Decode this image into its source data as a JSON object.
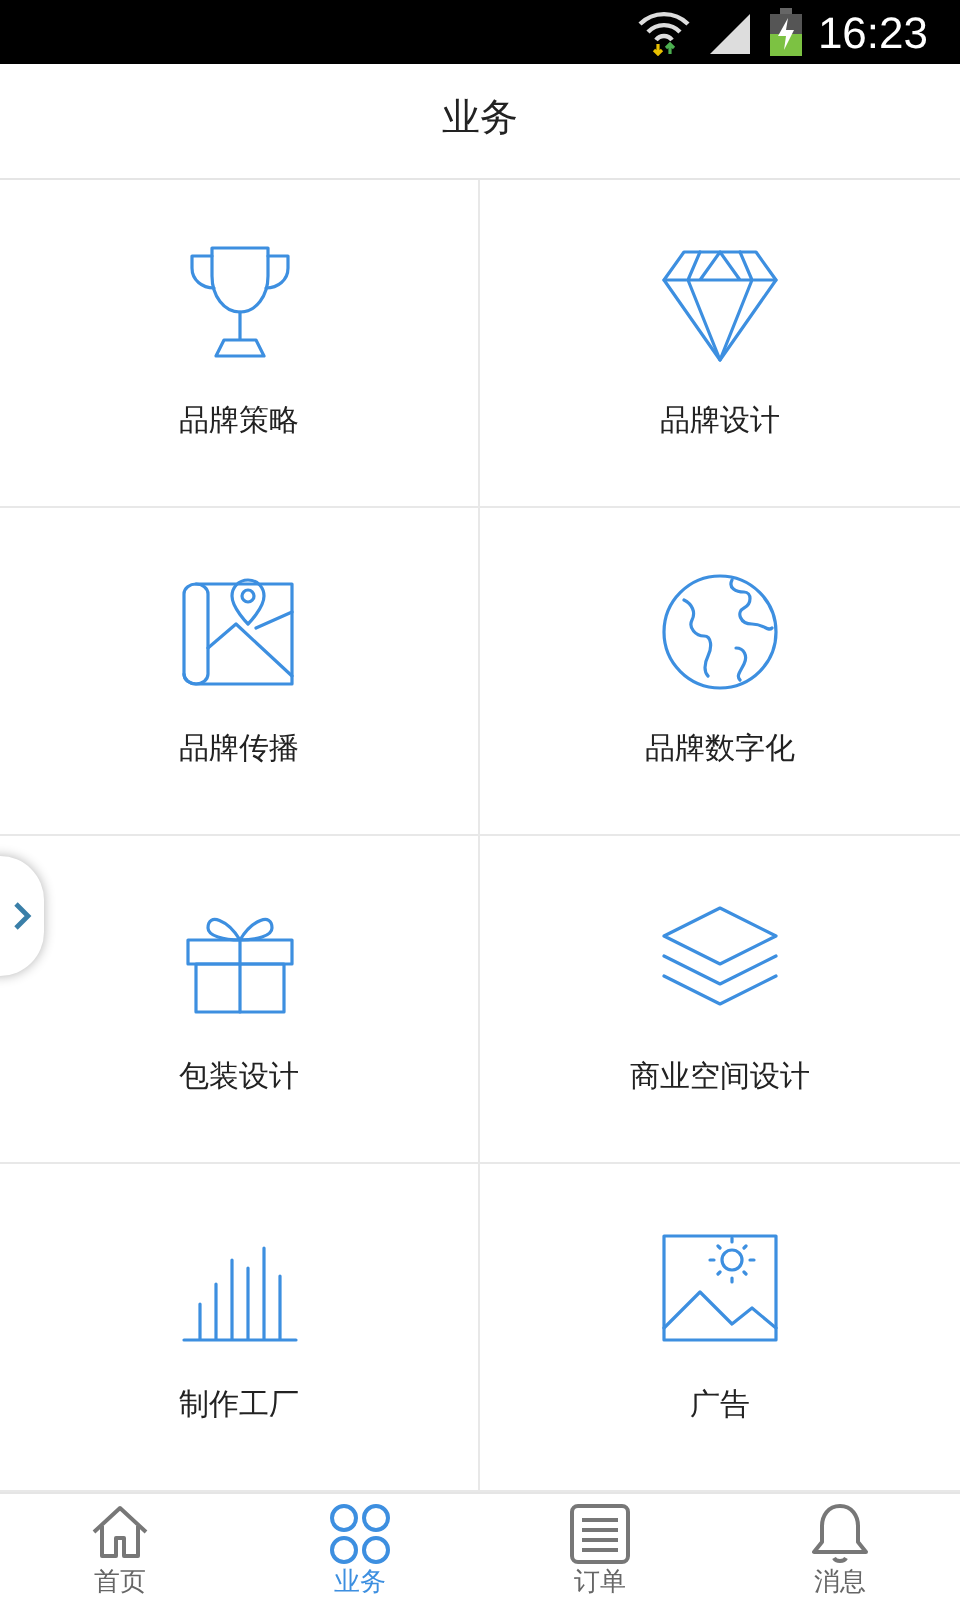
{
  "status_bar": {
    "time": "16:23"
  },
  "header": {
    "title": "业务"
  },
  "services": [
    {
      "label": "品牌策略",
      "kind": "trophy"
    },
    {
      "label": "品牌设计",
      "kind": "diamond"
    },
    {
      "label": "品牌传播",
      "kind": "map"
    },
    {
      "label": "品牌数字化",
      "kind": "globe"
    },
    {
      "label": "包装设计",
      "kind": "gift"
    },
    {
      "label": "商业空间设计",
      "kind": "layers"
    },
    {
      "label": "制作工厂",
      "kind": "bars"
    },
    {
      "label": "广告",
      "kind": "image"
    }
  ],
  "bottom_nav": [
    {
      "label": "首页",
      "kind": "home",
      "selected": false
    },
    {
      "label": "业务",
      "kind": "grid",
      "selected": true
    },
    {
      "label": "订单",
      "kind": "list",
      "selected": false
    },
    {
      "label": "消息",
      "kind": "bell",
      "selected": false
    }
  ]
}
